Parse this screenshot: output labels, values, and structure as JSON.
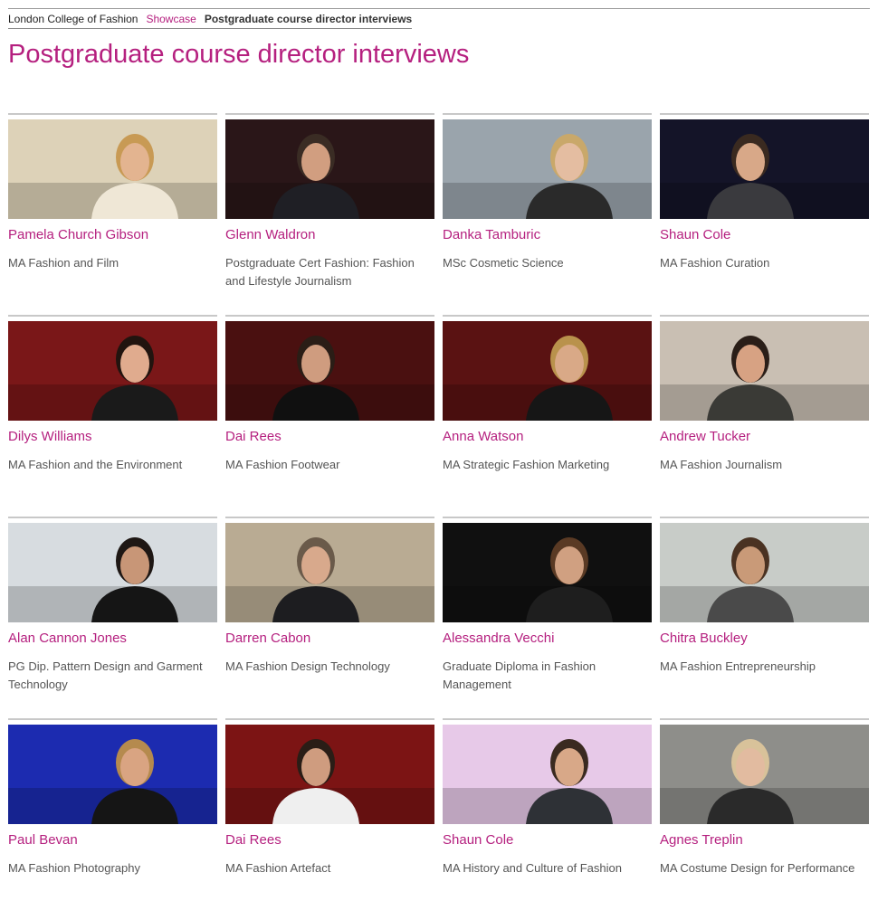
{
  "breadcrumb": {
    "home": "London College of Fashion",
    "section": "Showcase",
    "current": "Postgraduate course director interviews"
  },
  "page": {
    "title": "Postgraduate course director interviews"
  },
  "interviews": [
    {
      "name": "Pamela Church Gibson",
      "course": "MA Fashion and Film",
      "bg": "#ddd2b8",
      "shirt": "#efe7d6",
      "hair": "#c89a54",
      "skin": "#e3b490"
    },
    {
      "name": "Glenn Waldron",
      "course": "Postgraduate Cert Fashion: Fashion and Lifestyle Journalism",
      "bg": "#2a1618",
      "shirt": "#1f1f25",
      "hair": "#3a2c24",
      "skin": "#d19e80"
    },
    {
      "name": "Danka Tamburic",
      "course": "MSc Cosmetic Science",
      "bg": "#9aa4ac",
      "shirt": "#2a2a2a",
      "hair": "#c9a86a",
      "skin": "#e4bda1"
    },
    {
      "name": "Shaun Cole",
      "course": "MA Fashion Curation",
      "bg": "#141428",
      "shirt": "#3a3a3e",
      "hair": "#3a2a20",
      "skin": "#d8a888"
    },
    {
      "name": "Dilys Williams",
      "course": "MA Fashion and the Environment",
      "bg": "#7a1718",
      "shirt": "#1a1a1a",
      "hair": "#21140f",
      "skin": "#e0ab8e"
    },
    {
      "name": "Dai Rees",
      "course": "MA Fashion Footwear",
      "bg": "#4a1010",
      "shirt": "#101010",
      "hair": "#2a1d16",
      "skin": "#cf9c7f"
    },
    {
      "name": "Anna Watson",
      "course": "MA Strategic Fashion Marketing",
      "bg": "#5a1212",
      "shirt": "#161616",
      "hair": "#b9924c",
      "skin": "#d9a987"
    },
    {
      "name": "Andrew Tucker",
      "course": "MA Fashion Journalism",
      "bg": "#c9bfb3",
      "shirt": "#3a3a36",
      "hair": "#2a1e18",
      "skin": "#d7a283"
    },
    {
      "name": "Alan Cannon Jones",
      "course": "PG Dip. Pattern Design and Garment Technology",
      "bg": "#d7dce0",
      "shirt": "#151515",
      "hair": "#1e1714",
      "skin": "#c89677"
    },
    {
      "name": "Darren Cabon",
      "course": "MA Fashion Design Technology",
      "bg": "#b9ab93",
      "shirt": "#1d1d20",
      "hair": "#6a5a4a",
      "skin": "#d8a98c"
    },
    {
      "name": "Alessandra Vecchi",
      "course": "Graduate Diploma in Fashion Management",
      "bg": "#101010",
      "shirt": "#1e1e1e",
      "hair": "#5a3a24",
      "skin": "#d0a081"
    },
    {
      "name": "Chitra Buckley",
      "course": "MA Fashion Entrepreneurship",
      "bg": "#c8ccc8",
      "shirt": "#4a4a4a",
      "hair": "#4a3222",
      "skin": "#c99a78"
    },
    {
      "name": "Paul Bevan",
      "course": "MA Fashion Photography",
      "bg": "#1c2bb0",
      "shirt": "#151515",
      "hair": "#b58a4e",
      "skin": "#d9a482"
    },
    {
      "name": "Dai Rees",
      "course": "MA Fashion Artefact",
      "bg": "#7c1414",
      "shirt": "#efefef",
      "hair": "#2a1d16",
      "skin": "#cf9c7f"
    },
    {
      "name": "Shaun Cole",
      "course": "MA History and Culture of Fashion",
      "bg": "#e7c9e8",
      "shirt": "#2e3136",
      "hair": "#3a2a20",
      "skin": "#d8a888"
    },
    {
      "name": "Agnes Treplin",
      "course": "MA Costume Design for Performance",
      "bg": "#8e8e8a",
      "shirt": "#2a2a2a",
      "hair": "#d8c29a",
      "skin": "#e2bba0"
    }
  ]
}
